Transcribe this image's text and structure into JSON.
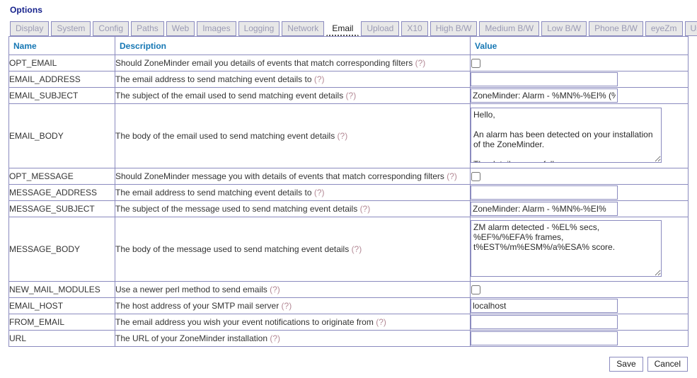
{
  "page": {
    "title": "Options"
  },
  "tabs": [
    {
      "label": "Display",
      "active": false
    },
    {
      "label": "System",
      "active": false
    },
    {
      "label": "Config",
      "active": false
    },
    {
      "label": "Paths",
      "active": false
    },
    {
      "label": "Web",
      "active": false
    },
    {
      "label": "Images",
      "active": false
    },
    {
      "label": "Logging",
      "active": false
    },
    {
      "label": "Network",
      "active": false
    },
    {
      "label": "Email",
      "active": true
    },
    {
      "label": "Upload",
      "active": false
    },
    {
      "label": "X10",
      "active": false
    },
    {
      "label": "High B/W",
      "active": false
    },
    {
      "label": "Medium B/W",
      "active": false
    },
    {
      "label": "Low B/W",
      "active": false
    },
    {
      "label": "Phone B/W",
      "active": false
    },
    {
      "label": "eyeZm",
      "active": false
    },
    {
      "label": "Users",
      "active": false
    }
  ],
  "table": {
    "headers": {
      "name": "Name",
      "description": "Description",
      "value": "Value"
    },
    "help_marker": "(?)",
    "rows": [
      {
        "name": "OPT_EMAIL",
        "description": "Should ZoneMinder email you details of events that match corresponding filters",
        "control": "checkbox",
        "checked": false,
        "value": ""
      },
      {
        "name": "EMAIL_ADDRESS",
        "description": "The email address to send matching event details to",
        "control": "text",
        "value": ""
      },
      {
        "name": "EMAIL_SUBJECT",
        "description": "The subject of the email used to send matching event details",
        "control": "text",
        "value": "ZoneMinder: Alarm - %MN%-%EI% (%ESM%)"
      },
      {
        "name": "EMAIL_BODY",
        "description": "The body of the email used to send matching event details",
        "control": "textarea-email",
        "value": "Hello,\n\nAn alarm has been detected on your installation of the ZoneMinder.\n\nThe details are as follows :-"
      },
      {
        "name": "OPT_MESSAGE",
        "description": "Should ZoneMinder message you with details of events that match corresponding filters",
        "control": "checkbox",
        "checked": false,
        "value": ""
      },
      {
        "name": "MESSAGE_ADDRESS",
        "description": "The email address to send matching event details to",
        "control": "text",
        "value": ""
      },
      {
        "name": "MESSAGE_SUBJECT",
        "description": "The subject of the message used to send matching event details",
        "control": "text",
        "value": "ZoneMinder: Alarm - %MN%-%EI%"
      },
      {
        "name": "MESSAGE_BODY",
        "description": "The body of the message used to send matching event details",
        "control": "textarea-message",
        "value": "ZM alarm detected - %EL% secs, %EF%/%EFA% frames, t%EST%/m%ESM%/a%ESA% score."
      },
      {
        "name": "NEW_MAIL_MODULES",
        "description": "Use a newer perl method to send emails",
        "control": "checkbox",
        "checked": false,
        "value": ""
      },
      {
        "name": "EMAIL_HOST",
        "description": "The host address of your SMTP mail server",
        "control": "text",
        "value": "localhost"
      },
      {
        "name": "FROM_EMAIL",
        "description": "The email address you wish your event notifications to originate from",
        "control": "text",
        "value": ""
      },
      {
        "name": "URL",
        "description": "The URL of your ZoneMinder installation",
        "control": "text",
        "value": ""
      }
    ]
  },
  "footer": {
    "save_label": "Save",
    "cancel_label": "Cancel"
  },
  "colors": {
    "title": "#16228c",
    "header_text": "#1577b4",
    "border": "#8b8bbf",
    "help_link": "#b48a96",
    "tab_inactive_bg": "#e8e8e8",
    "tab_inactive_text": "#9a9ab4"
  }
}
